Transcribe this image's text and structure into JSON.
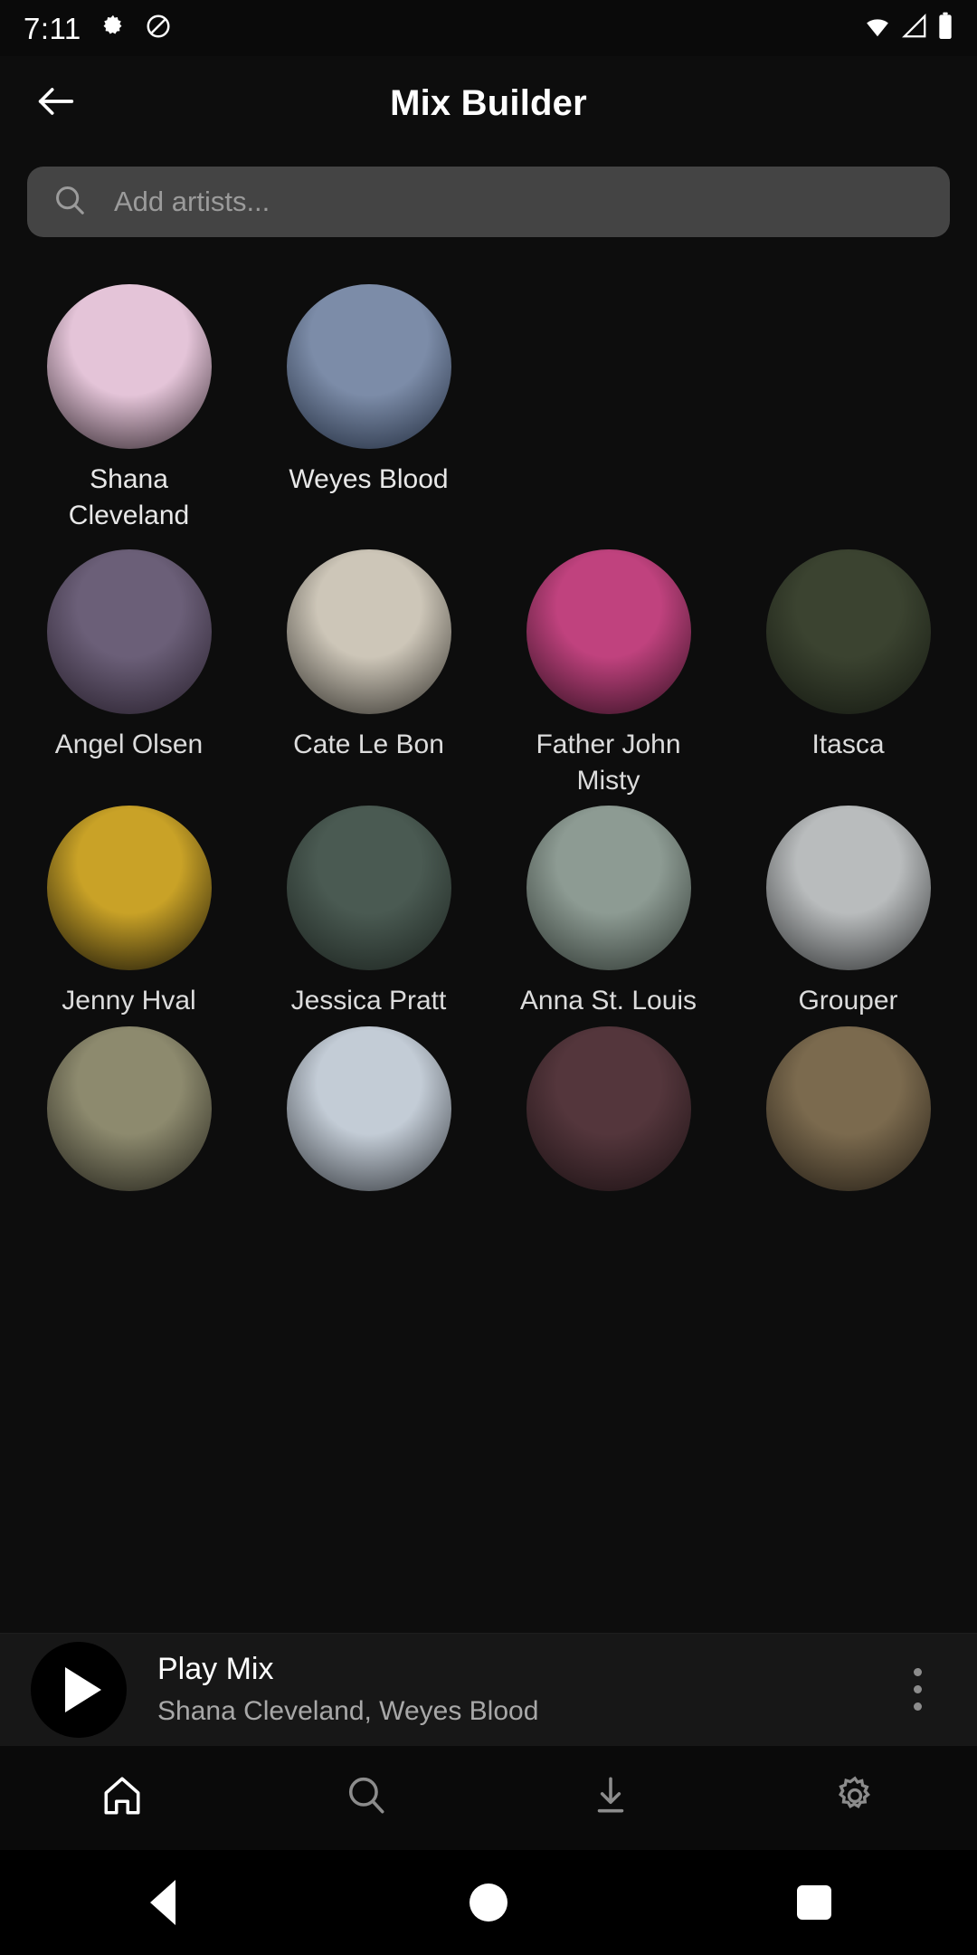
{
  "status_bar": {
    "time": "7:11",
    "left_icons": [
      "gear-icon",
      "do-not-disturb-icon"
    ],
    "right_icons": [
      "wifi-icon",
      "cell-signal-icon",
      "battery-icon"
    ]
  },
  "header": {
    "back_icon": "arrow-left-icon",
    "title": "Mix Builder"
  },
  "search": {
    "icon": "search-icon",
    "value": "",
    "placeholder": "Add artists..."
  },
  "selected_artists": [
    {
      "name": "Shana Cleveland",
      "bg": "#e4c4d8",
      "tone2": "#2a2026"
    },
    {
      "name": "Weyes Blood",
      "bg": "#7c8ca8",
      "tone2": "#1d2738"
    }
  ],
  "suggested_artists": [
    {
      "name": "Angel Olsen",
      "bg": "#6b5f78",
      "tone2": "#241c28"
    },
    {
      "name": "Cate Le Bon",
      "bg": "#cdc6b8",
      "tone2": "#2e2c27"
    },
    {
      "name": "Father John Misty",
      "bg": "#c0427e",
      "tone2": "#2a0e1c"
    },
    {
      "name": "Itasca",
      "bg": "#3b4330",
      "tone2": "#131710"
    },
    {
      "name": "Jenny Hval",
      "bg": "#c9a227",
      "tone2": "#0f0d06"
    },
    {
      "name": "Jessica Pratt",
      "bg": "#4a5a52",
      "tone2": "#1a211d"
    },
    {
      "name": "Anna St. Louis",
      "bg": "#8d9b93",
      "tone2": "#2b332e"
    },
    {
      "name": "Grouper",
      "bg": "#b9bcbd",
      "tone2": "#2c2e2f"
    },
    {
      "name": "",
      "bg": "#8d8a6e",
      "tone2": "#201f18"
    },
    {
      "name": "",
      "bg": "#c3ccd6",
      "tone2": "#2f3338"
    },
    {
      "name": "",
      "bg": "#54363c",
      "tone2": "#1a1012"
    },
    {
      "name": "",
      "bg": "#7b6a4e",
      "tone2": "#221c14"
    }
  ],
  "player": {
    "play_icon": "play-icon",
    "title": "Play Mix",
    "subtitle": "Shana Cleveland, Weyes Blood",
    "menu_icon": "more-vertical-icon"
  },
  "bottom_nav": [
    {
      "icon": "home-icon",
      "active": true
    },
    {
      "icon": "search-icon",
      "active": false
    },
    {
      "icon": "download-icon",
      "active": false
    },
    {
      "icon": "gear-icon",
      "active": false
    }
  ],
  "system_nav": [
    {
      "icon": "android-back-icon"
    },
    {
      "icon": "android-home-icon"
    },
    {
      "icon": "android-recents-icon"
    }
  ],
  "colors": {
    "background": "#0d0d0d",
    "surface": "#171717",
    "search_field": "#444444",
    "text_primary": "#ffffff",
    "text_secondary": "#a8a8a8",
    "nav_active": "#ffffff",
    "nav_inactive": "#8c8c8c"
  }
}
